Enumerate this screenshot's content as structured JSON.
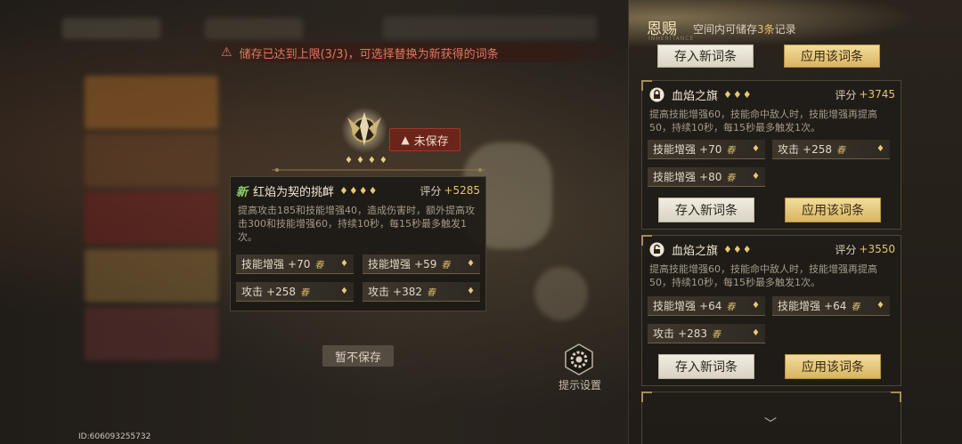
{
  "warning": {
    "text": "储存已达到上限(3/3)，可选择替换为新获得的词条"
  },
  "badge": {
    "unsaved": "未保存"
  },
  "main_card": {
    "new_tag": "新",
    "title": "红焰为契的挑衅",
    "gems": "♦♦♦♦",
    "score_label": "评分",
    "score_value": "+5285",
    "description": "提高攻击185和技能增强40，造成伤害时，额外提高攻击300和技能增强60，持续10秒，每15秒最多触发1次。",
    "stats": [
      {
        "label": "技能增强",
        "value": "+70"
      },
      {
        "label": "技能增强",
        "value": "+59"
      },
      {
        "label": "攻击",
        "value": "+258"
      },
      {
        "label": "攻击",
        "value": "+382"
      }
    ]
  },
  "skip_button": "暂不保存",
  "settings_label": "提示设置",
  "id_text": "ID:606093255732",
  "right_panel": {
    "title": "恩赐",
    "subtitle": "INHERITANCE",
    "note_prefix": "空间内可储存",
    "note_highlight": "3条",
    "note_suffix": "记录",
    "btn_store": "存入新词条",
    "btn_apply": "应用该词条",
    "entries": [
      {
        "title": "血焰之旗",
        "gems": "♦♦♦",
        "score_label": "评分",
        "score_value": "+3745",
        "description": "提高技能增强60，技能命中敌人时，技能增强再提高50，持续10秒，每15秒最多触发1次。",
        "stats": [
          {
            "label": "技能增强",
            "value": "+70"
          },
          {
            "label": "攻击",
            "value": "+258"
          },
          {
            "label": "技能增强",
            "value": "+80"
          }
        ]
      },
      {
        "title": "血焰之旗",
        "gems": "♦♦♦",
        "score_label": "评分",
        "score_value": "+3550",
        "description": "提高技能增强60，技能命中敌人时，技能增强再提高50，持续10秒，每15秒最多触发1次。",
        "stats": [
          {
            "label": "技能增强",
            "value": "+64"
          },
          {
            "label": "技能增强",
            "value": "+64"
          },
          {
            "label": "攻击",
            "value": "+283"
          }
        ]
      }
    ]
  },
  "rune_glyph": "春",
  "colors": {
    "accent_gold": "#e7c36b",
    "warning_red": "#e0785e",
    "new_green": "#8fd06a"
  }
}
